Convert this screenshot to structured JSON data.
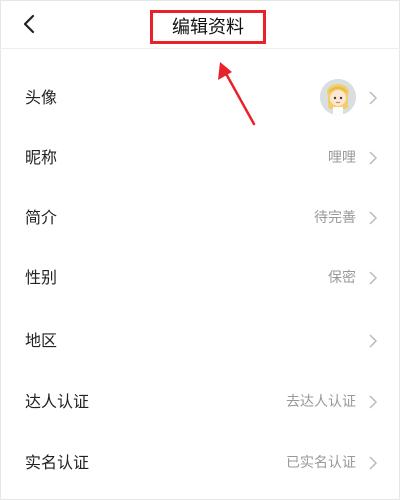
{
  "header": {
    "back_icon": "chevron-left-icon",
    "title": "编辑资料"
  },
  "rows": [
    {
      "label": "头像",
      "value": "",
      "type": "avatar",
      "icon": "avatar-image"
    },
    {
      "label": "昵称",
      "value": "哩哩"
    },
    {
      "label": "简介",
      "value": "待完善"
    },
    {
      "label": "性别",
      "value": "保密"
    },
    {
      "label": "地区",
      "value": ""
    },
    {
      "label": "达人认证",
      "value": "去达人认证"
    },
    {
      "label": "实名认证",
      "value": "已实名认证"
    }
  ],
  "colors": {
    "annotation": "#e8212a",
    "label": "#222222",
    "value": "#999999",
    "chevron": "#bbbbbb"
  }
}
